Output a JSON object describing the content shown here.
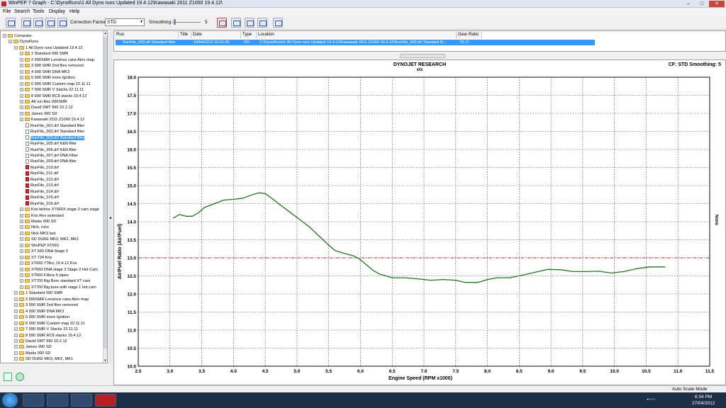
{
  "window": {
    "title": "WinPEP 7    Graph - C:\\DynoRuns\\1 All Dyno runs Updated 19.4.12\\Kawasaki 2011 Z1000 19.4.12\\",
    "minimize": "–",
    "maximize": "□",
    "close": "✕"
  },
  "menu": [
    "File",
    "Search",
    "Tools",
    "Display",
    "Help"
  ],
  "toolbar": {
    "correction_label": "Correction Factor:",
    "correction_value": "STD",
    "smoothing_label": "Smoothing:",
    "smoothing_value": "5"
  },
  "tree": {
    "items": [
      {
        "label": "Computer",
        "level": 0,
        "kind": "computer"
      },
      {
        "label": "DynoRuns",
        "level": 1,
        "kind": "folder"
      },
      {
        "label": "1 All Dyno runs Updated 19.4.12",
        "level": 2,
        "kind": "folder"
      },
      {
        "label": "1 Standard 990 SMR",
        "level": 3,
        "kind": "folder"
      },
      {
        "label": "2 990SMR Leovince cans Akro map",
        "level": 3,
        "kind": "folder"
      },
      {
        "label": "3 990 SMR 2nd files removed",
        "level": 3,
        "kind": "folder"
      },
      {
        "label": "4 990 SMR DNA MK3",
        "level": 3,
        "kind": "folder"
      },
      {
        "label": "5 990 SMR more Ignition",
        "level": 3,
        "kind": "folder"
      },
      {
        "label": "6 990 SMR Custom map 22.11.11",
        "level": 3,
        "kind": "folder"
      },
      {
        "label": "7 990 SMR  V Stacks 22.11.11",
        "level": 3,
        "kind": "folder"
      },
      {
        "label": "8 990 SMR RC8 stacks 19.4.12",
        "level": 3,
        "kind": "folder"
      },
      {
        "label": "All run files 990SMR",
        "level": 3,
        "kind": "folder"
      },
      {
        "label": "David SMT 990 10.2.12",
        "level": 3,
        "kind": "folder"
      },
      {
        "label": "James 990 SD",
        "level": 3,
        "kind": "folder"
      },
      {
        "label": "Kawasaki 2011 Z1000 19.4.12",
        "level": 3,
        "kind": "folder"
      },
      {
        "label": "RunFile_001.drf Standard filter",
        "level": 4,
        "kind": "file"
      },
      {
        "label": "RunFile_002.drf Standard filter",
        "level": 4,
        "kind": "file"
      },
      {
        "label": "RunFile_003.drf Standard filter",
        "level": 4,
        "kind": "file",
        "selected": true
      },
      {
        "label": "RunFile_005.drf K&N filter",
        "level": 4,
        "kind": "file"
      },
      {
        "label": "RunFile_006.drf K&N filter",
        "level": 4,
        "kind": "file"
      },
      {
        "label": "RunFile_007.drf DNA Filter",
        "level": 4,
        "kind": "file"
      },
      {
        "label": "RunFile_009.drf DNA filter",
        "level": 4,
        "kind": "file"
      },
      {
        "label": "RunFile_010.drf",
        "level": 4,
        "kind": "filer"
      },
      {
        "label": "RunFile_011.drf",
        "level": 4,
        "kind": "filer"
      },
      {
        "label": "RunFile_012.drf",
        "level": 4,
        "kind": "filer"
      },
      {
        "label": "RunFile_013.drf",
        "level": 4,
        "kind": "filer"
      },
      {
        "label": "RunFile_014.drf",
        "level": 4,
        "kind": "filer"
      },
      {
        "label": "RunFile_015.drf",
        "level": 4,
        "kind": "filer"
      },
      {
        "label": "RunFile_016.drf",
        "level": 4,
        "kind": "filer"
      },
      {
        "label": "Kris before XT660X stage 2 cam stage",
        "level": 3,
        "kind": "folder"
      },
      {
        "label": "Kris Rev extended",
        "level": 3,
        "kind": "folder"
      },
      {
        "label": "Marks 990 SD",
        "level": 3,
        "kind": "folder"
      },
      {
        "label": "Nick, runs",
        "level": 3,
        "kind": "folder"
      },
      {
        "label": "Nick MK3 last",
        "level": 3,
        "kind": "folder"
      },
      {
        "label": "SD DUKE MK3, MK2, MK1",
        "level": 3,
        "kind": "folder"
      },
      {
        "label": "WinPEP XT660",
        "level": 3,
        "kind": "folder"
      },
      {
        "label": "XT 660 DNA Stage 3",
        "level": 3,
        "kind": "folder"
      },
      {
        "label": "XT 734 Kris",
        "level": 3,
        "kind": "folder"
      },
      {
        "label": "XT660 778cc 19.4.12 Kris",
        "level": 3,
        "kind": "folder"
      },
      {
        "label": "XT660 DNA stage 3 Stage 2 Hot Cam",
        "level": 3,
        "kind": "folder"
      },
      {
        "label": "XT660 Filters 6 pipes",
        "level": 3,
        "kind": "folder"
      },
      {
        "label": "XT700 Big Bore standard XT cam",
        "level": 3,
        "kind": "folder"
      },
      {
        "label": "XT700 Big bore with stage 1 hot cam",
        "level": 3,
        "kind": "folder"
      },
      {
        "label": "1 Standard 990 SMR",
        "level": 2,
        "kind": "folder"
      },
      {
        "label": "2 990SMR Leovince cans Akro map",
        "level": 2,
        "kind": "folder"
      },
      {
        "label": "3 990 SMR 2nd files removed",
        "level": 2,
        "kind": "folder"
      },
      {
        "label": "4 990 SMR DNA MK3",
        "level": 2,
        "kind": "folder"
      },
      {
        "label": "5 990 SMR more Ignition",
        "level": 2,
        "kind": "folder"
      },
      {
        "label": "6 990 SMR Custom map 22.11.11",
        "level": 2,
        "kind": "folder"
      },
      {
        "label": "7 990 SMR  V Stacks 22.11.11",
        "level": 2,
        "kind": "folder"
      },
      {
        "label": "8 990 SMR RC8 stacks 19.4.12",
        "level": 2,
        "kind": "folder"
      },
      {
        "label": "David SMT 990 10.2.12",
        "level": 2,
        "kind": "folder"
      },
      {
        "label": "James 990 SD",
        "level": 2,
        "kind": "folder"
      },
      {
        "label": "Marks 990 SD",
        "level": 2,
        "kind": "folder"
      },
      {
        "label": "SD DUKE MK3, MK2, MK1",
        "level": 2,
        "kind": "folder"
      }
    ]
  },
  "runs_table": {
    "headers": [
      "Run",
      "Title",
      "Date",
      "Type",
      "Location",
      "Gear Ratio"
    ],
    "row": {
      "run": "RunFile_003.drf Standard filter",
      "title": "",
      "date": "19/04/2012 10:21:26",
      "type": "RO",
      "location": "C:\\DynoRuns\\1 All Dyno runs Updated 19.4.12\\Kawasaki 2011 Z1000 19.4.12\\RunFile_003.drf Standard fil...",
      "gear_ratio": "79.17"
    }
  },
  "graph_header": {
    "brand": "DYNOJET RESEARCH",
    "subtitle": "xtx",
    "info": "CF: STD  Smoothing: 5",
    "right_label": "None"
  },
  "chart_data": {
    "type": "line",
    "title": "DYNOJET RESEARCH",
    "subtitle": "xtx",
    "xlabel": "Engine Speed (RPM x1000)",
    "ylabel": "Air/Fuel Ratio (Air/Fuel)",
    "xlim": [
      2.5,
      11.5
    ],
    "ylim": [
      10.0,
      18.0
    ],
    "xticks": [
      "2.5",
      "3.0",
      "3.5",
      "4.0",
      "4.5",
      "5.0",
      "5.5",
      "6.0",
      "6.5",
      "7.0",
      "7.5",
      "8.0",
      "8.5",
      "9.0",
      "9.5",
      "10.0",
      "10.5",
      "11.0",
      "11.5"
    ],
    "yticks": [
      "10.0",
      "10.5",
      "11.0",
      "11.5",
      "12.0",
      "12.5",
      "13.0",
      "13.5",
      "14.0",
      "14.5",
      "15.0",
      "15.5",
      "16.0",
      "16.5",
      "17.0",
      "17.5",
      "18.0"
    ],
    "grid": true,
    "reference_line": {
      "y": 13.0,
      "color": "#c0202a",
      "style": "dash-dot"
    },
    "series": [
      {
        "color": "#1a7a1a",
        "x": [
          3.05,
          3.15,
          3.25,
          3.35,
          3.45,
          3.55,
          3.7,
          3.85,
          4.0,
          4.15,
          4.3,
          4.4,
          4.5,
          4.6,
          4.75,
          4.9,
          5.05,
          5.2,
          5.35,
          5.5,
          5.6,
          5.75,
          5.9,
          6.0,
          6.1,
          6.2,
          6.3,
          6.5,
          6.7,
          6.9,
          7.1,
          7.3,
          7.5,
          7.65,
          7.85,
          8.0,
          8.15,
          8.35,
          8.55,
          8.75,
          8.95,
          9.15,
          9.35,
          9.55,
          9.75,
          9.95,
          10.15,
          10.35,
          10.55,
          10.8
        ],
        "y": [
          14.1,
          14.2,
          14.15,
          14.15,
          14.25,
          14.4,
          14.5,
          14.6,
          14.62,
          14.65,
          14.75,
          14.8,
          14.78,
          14.65,
          14.45,
          14.25,
          14.05,
          13.85,
          13.6,
          13.35,
          13.2,
          13.12,
          13.05,
          12.95,
          12.8,
          12.65,
          12.55,
          12.45,
          12.45,
          12.42,
          12.38,
          12.4,
          12.38,
          12.32,
          12.32,
          12.4,
          12.45,
          12.45,
          12.52,
          12.6,
          12.68,
          12.67,
          12.62,
          12.62,
          12.63,
          12.58,
          12.62,
          12.7,
          12.75,
          12.75
        ]
      }
    ]
  },
  "status": {
    "auto_scale": "Auto Scale Mode"
  },
  "taskbar": {
    "time": "6:34 PM",
    "date": "27/04/2012"
  }
}
